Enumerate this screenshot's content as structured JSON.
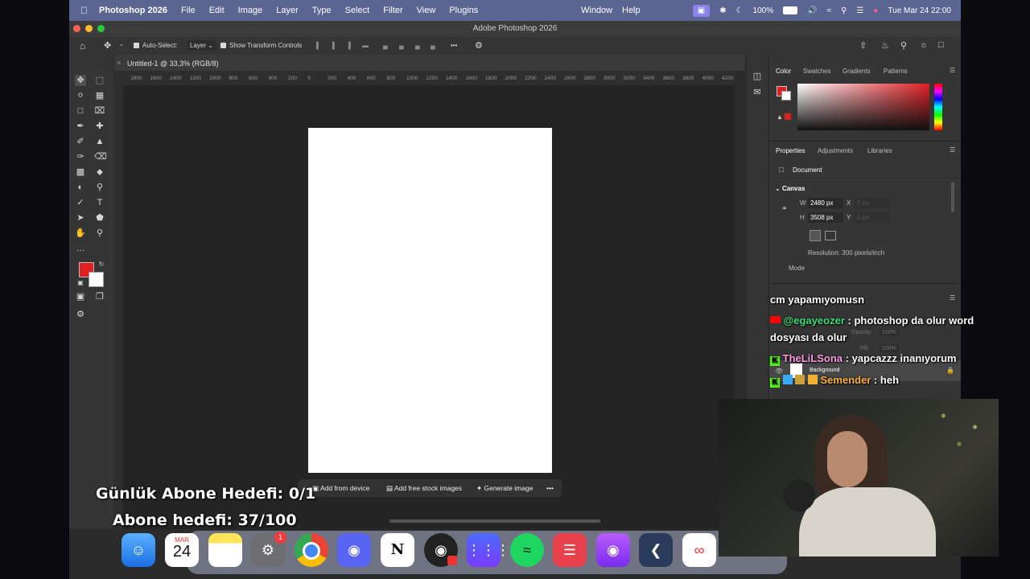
{
  "menubar": {
    "app_name": "Photoshop 2026",
    "items": [
      "File",
      "Edit",
      "Image",
      "Layer",
      "Type",
      "Select",
      "Filter",
      "View",
      "Plugins"
    ],
    "right_items": [
      "Window",
      "Help"
    ],
    "battery": "100%",
    "clock": "Tue Mar 24  22:00"
  },
  "window": {
    "title": "Adobe Photoshop 2026"
  },
  "options_bar": {
    "auto_select_label": "Auto-Select:",
    "auto_select_value": "Layer",
    "transform_label": "Show Transform Controls",
    "more_label": "•••"
  },
  "document": {
    "tab_title": "Untitled-1 @ 33,3% (RGB/8)",
    "ruler_ticks": [
      "1800",
      "1600",
      "1400",
      "1200",
      "1000",
      "800",
      "600",
      "400",
      "200",
      "0",
      "200",
      "400",
      "600",
      "800",
      "1000",
      "1200",
      "1400",
      "1600",
      "1800",
      "2000",
      "2200",
      "2400",
      "2600",
      "2800",
      "3000",
      "3200",
      "3400",
      "3600",
      "3800",
      "4000",
      "4200"
    ]
  },
  "contextual_taskbar": {
    "add_from_device": "Add from device",
    "add_stock": "Add free stock images",
    "generate": "Generate image",
    "more": "•••"
  },
  "color_panel": {
    "tabs": [
      "Color",
      "Swatches",
      "Gradients",
      "Patterns"
    ],
    "foreground": "#e02020",
    "background": "#ffffff"
  },
  "properties_panel": {
    "tabs": [
      "Properties",
      "Adjustments",
      "Libraries"
    ],
    "kind": "Document",
    "section": "Canvas",
    "w_label": "W",
    "w_value": "2480 px",
    "h_label": "H",
    "h_value": "3508 px",
    "x_label": "X",
    "x_value": "0 px",
    "y_label": "Y",
    "y_value": "0 px",
    "resolution": "Resolution: 300 pixels/inch",
    "mode_label": "Mode"
  },
  "layers_ghost": {
    "opacity": "Opacity:",
    "opacity_value": "100%",
    "fill": "Fill:",
    "fill_value": "100%",
    "layer_name": "Background"
  },
  "dock": {
    "calendar_month": "MAR",
    "calendar_day": "24",
    "settings_badge": "1"
  },
  "overlay": {
    "daily_goal": "Günlük Abone Hedefi: 0/1",
    "sub_goal": "Abone hedefi: 37/100"
  },
  "chat": [
    {
      "user": "",
      "message": "cm yapamıyomusn"
    },
    {
      "user": "@egayeozer",
      "message": " : photoshop da olur word"
    },
    {
      "user": "",
      "message": "dosyası da olur"
    },
    {
      "user": "TheLiLSona",
      "message": " : yapcazzz inanıyorum"
    },
    {
      "user": "Semender",
      "message": " : heh"
    }
  ],
  "colors": {
    "menubar": "#5a6691",
    "user_egayeozer": "#3de07a",
    "user_thelilsona": "#ff9be0",
    "user_semender": "#ffb13b",
    "ps_bg": "#2b2b2b"
  }
}
